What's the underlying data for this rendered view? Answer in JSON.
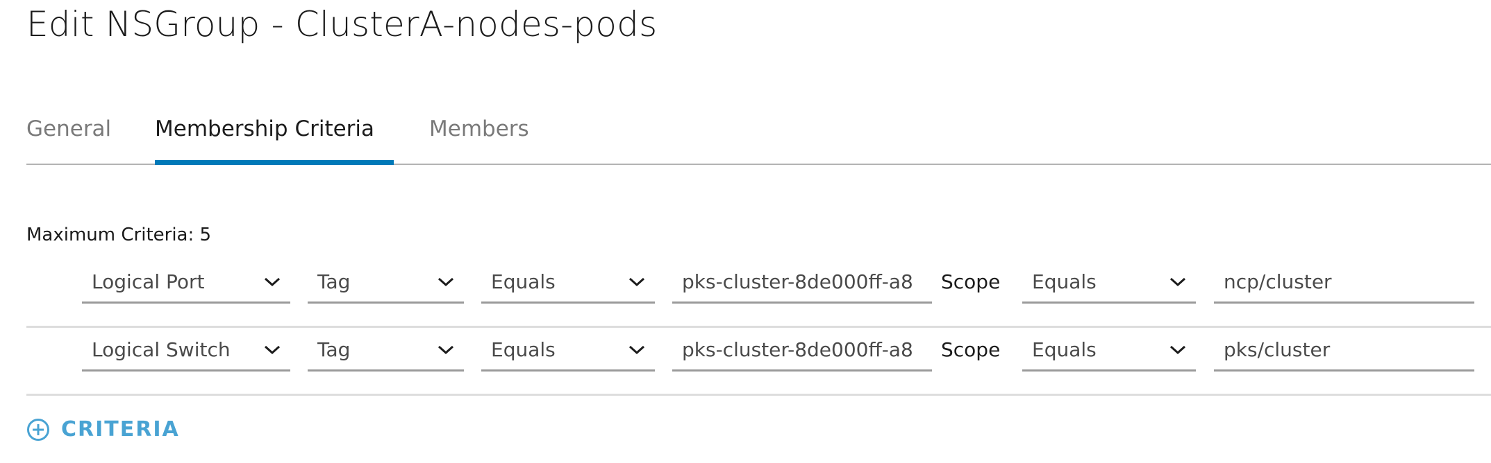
{
  "header": {
    "title": "Edit NSGroup - ClusterA-nodes-pods"
  },
  "tabs": [
    {
      "label": "General",
      "active": false
    },
    {
      "label": "Membership Criteria",
      "active": true
    },
    {
      "label": "Members",
      "active": false
    }
  ],
  "criteria": {
    "max_label": "Maximum Criteria: 5",
    "rows": [
      {
        "object_type": "Logical Port",
        "attribute": "Tag",
        "operator": "Equals",
        "value": "pks-cluster-8de000ff-a8",
        "scope_label": "Scope",
        "scope_operator": "Equals",
        "scope_value": "ncp/cluster"
      },
      {
        "object_type": "Logical Switch",
        "attribute": "Tag",
        "operator": "Equals",
        "value": "pks-cluster-8de000ff-a8",
        "scope_label": "Scope",
        "scope_operator": "Equals",
        "scope_value": "pks/cluster"
      }
    ],
    "add_label": "CRITERIA"
  },
  "colors": {
    "accent": "#0079b8",
    "link": "#49a3d3"
  }
}
